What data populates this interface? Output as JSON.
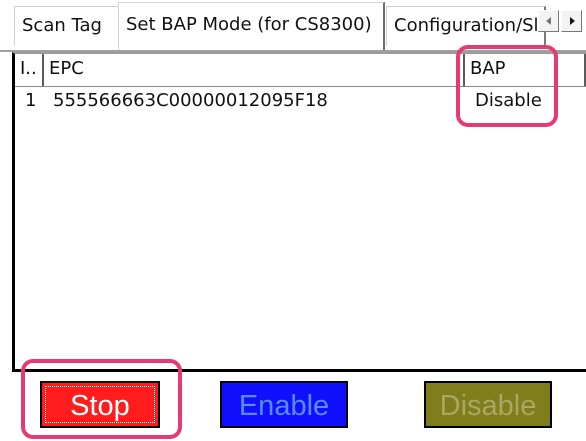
{
  "tabs": [
    {
      "label": "Scan Tag",
      "active": false
    },
    {
      "label": "Set BAP Mode (for CS8300)",
      "active": true
    },
    {
      "label": "Configuration/Sl",
      "active": false
    }
  ],
  "tab_scroll": {
    "left_icon": "chevron-left-icon",
    "right_icon": "chevron-right-icon"
  },
  "table": {
    "headers": {
      "index": "I..",
      "epc": "EPC",
      "bap": "BAP"
    },
    "rows": [
      {
        "index": "1",
        "epc": "555566663C00000012095F18",
        "bap": "Disable"
      }
    ]
  },
  "buttons": {
    "stop": "Stop",
    "enable": "Enable",
    "disable": "Disable"
  },
  "colors": {
    "stop_button": "#ff1c1c",
    "enable_button": "#1010ff",
    "disable_button": "#807e1c",
    "highlight": "#e43b76"
  }
}
